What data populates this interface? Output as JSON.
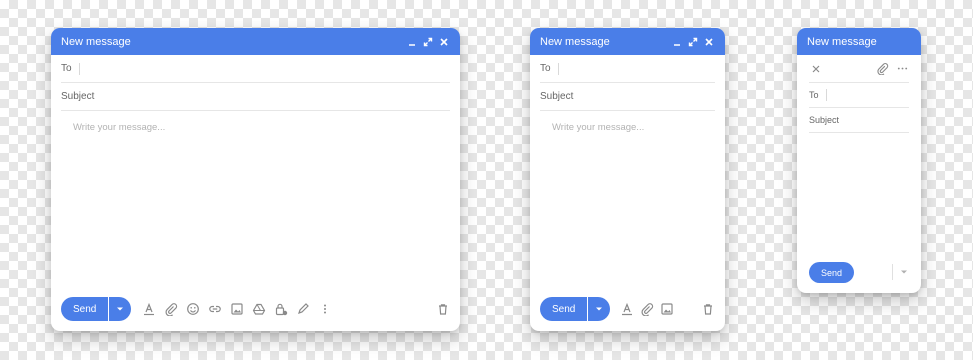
{
  "windows": {
    "large": {
      "title": "New message",
      "to_label": "To",
      "subject_label": "Subject",
      "body_placeholder": "Write your message...",
      "send_label": "Send"
    },
    "medium": {
      "title": "New message",
      "to_label": "To",
      "subject_label": "Subject",
      "body_placeholder": "Write your message...",
      "send_label": "Send"
    },
    "mobile": {
      "title": "New message",
      "to_label": "To",
      "subject_label": "Subject",
      "send_label": "Send"
    }
  },
  "colors": {
    "accent": "#4a7ee8",
    "icon": "#8a8a8a",
    "divider": "#e6e6e6"
  },
  "icons": [
    "minimize-icon",
    "expand-icon",
    "close-icon",
    "chevron-down-icon",
    "text-format-icon",
    "paperclip-icon",
    "emoji-icon",
    "link-icon",
    "image-icon",
    "drive-icon",
    "lock-icon",
    "pen-icon",
    "more-vertical-icon",
    "trash-icon",
    "more-horizontal-icon"
  ]
}
